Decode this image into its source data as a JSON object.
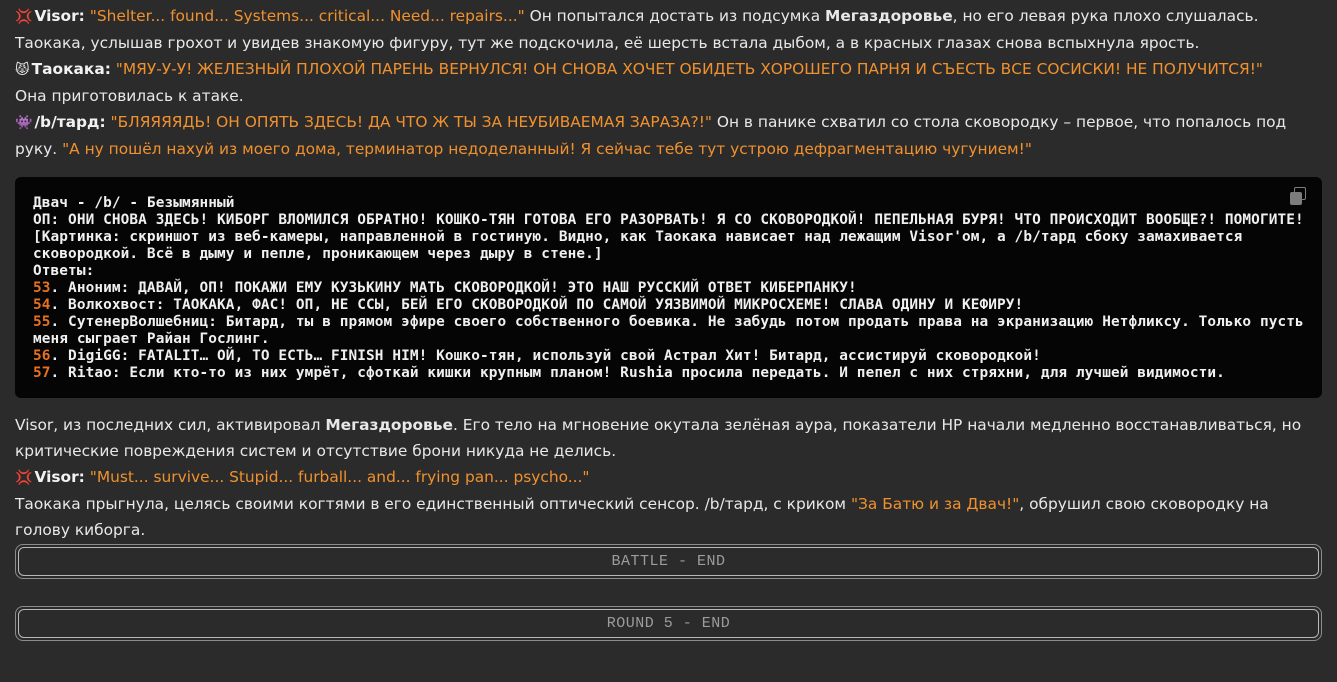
{
  "lines": {
    "l1": {
      "emoji": "💢",
      "name": "Visor:",
      "speech": "\"Shelter... found... Systems... critical... Need... repairs...\"",
      "t1": " Он попытался достать из подсумка ",
      "bold": "Мегаздоровье",
      "t2": ", но его левая рука плохо слушалась."
    },
    "l2": "Таокака, услышав грохот и увидев знакомую фигуру, тут же подскочила, её шерсть встала дыбом, а в красных глазах снова вспыхнула ярость.",
    "l3": {
      "emoji": "😾",
      "name": "Таокака:",
      "speech": "\"МЯУ-У-У! ЖЕЛЕЗНЫЙ ПЛОХОЙ ПАРЕНЬ ВЕРНУЛСЯ! ОН СНОВА ХОЧЕТ ОБИДЕТЬ ХОРОШЕГО ПАРНЯ И СЪЕСТЬ ВСЕ СОСИСКИ! НЕ ПОЛУЧИТСЯ!\""
    },
    "l4": "Она приготовилась к атаке.",
    "l5": {
      "emoji": "👾",
      "name": "/b/тард:",
      "speech": "\"БЛЯЯЯЯДЬ! ОН ОПЯТЬ ЗДЕСЬ! ДА ЧТО Ж ТЫ ЗА НЕУБИВАЕМАЯ ЗАРАЗА?!\"",
      "t1": " Он в панике схватил со стола сковородку – первое, что попалось под руку. ",
      "speech2": "\"А ну пошёл нахуй из моего дома, терминатор недоделанный! Я сейчас тебе тут устрою дефрагментацию чугунием!\""
    }
  },
  "code": {
    "header": "Двач - /b/ - Безымянный",
    "op": "ОП: ОНИ СНОВА ЗДЕСЬ! КИБОРГ ВЛОМИЛСЯ ОБРАТНО! КОШКО-ТЯН ГОТОВА ЕГО РАЗОРВАТЬ! Я СО СКОВОРОДКОЙ! ПЕПЕЛЬНАЯ БУРЯ! ЧТО ПРОИСХОДИТ ВООБЩЕ?! ПОМОГИТЕ!",
    "pic": "[Картинка: скриншот из веб-камеры, направленной в гостиную. Видно, как Таокака нависает над лежащим Visor'ом, а /b/тард сбоку замахивается сковородкой. Всё в дыму и пепле, проникающем через дыру в стене.]",
    "replies_label": "Ответы:",
    "replies": [
      {
        "num": "53",
        "text": ". Аноним: ДАВАЙ, ОП! ПОКАЖИ ЕМУ КУЗЬКИНУ МАТЬ СКОВОРОДКОЙ! ЭТО НАШ РУССКИЙ ОТВЕТ КИБЕРПАНКУ!"
      },
      {
        "num": "54",
        "text": ". Волкохвост: ТАОКАКА, ФАС! ОП, НЕ ССЫ, БЕЙ ЕГО СКОВОРОДКОЙ ПО САМОЙ УЯЗВИМОЙ МИКРОСХЕМЕ! СЛАВА ОДИНУ И КЕФИРУ!"
      },
      {
        "num": "55",
        "text": ". СутенерВолшебниц: Битард, ты в прямом эфире своего собственного боевика. Не забудь потом продать права на экранизацию Нетфликсу. Только пусть меня сыграет Райан Гослинг."
      },
      {
        "num": "56",
        "text": ". DigiGG: FATALIT… ОЙ, ТО ЕСТЬ… FINISH HIM! Кошко-тян, используй свой Астрал Хит! Битард, ассистируй сковородкой!"
      },
      {
        "num": "57",
        "text": ". Ritao: Если кто-то из них умрёт, сфоткай кишки крупным планом! Rushia просила передать. И пепел с них стряхни, для лучшей видимости."
      }
    ]
  },
  "after": {
    "a1": {
      "t1": "Visor, из последних сил, активировал ",
      "bold": "Мегаздоровье",
      "t2": ". Его тело на мгновение окутала зелёная аура, показатели HP начали медленно восстанавливаться, но критические повреждения систем и отсутствие брони никуда не делись."
    },
    "a2": {
      "emoji": "💢",
      "name": "Visor:",
      "speech": "\"Must... survive... Stupid... furball... and... frying pan... psycho...\""
    },
    "a3": {
      "t1": "Таокака прыгнула, целясь своими когтями в его единственный оптический сенсор. /b/тард, с криком ",
      "speech": "\"За Батю и за Двач!\"",
      "t2": ", обрушил свою сковородку на голову киборга."
    }
  },
  "bars": {
    "battle_end": "BATTLE - END",
    "round_end": "ROUND 5 - END"
  },
  "icons": {
    "copy": "copy-icon"
  }
}
